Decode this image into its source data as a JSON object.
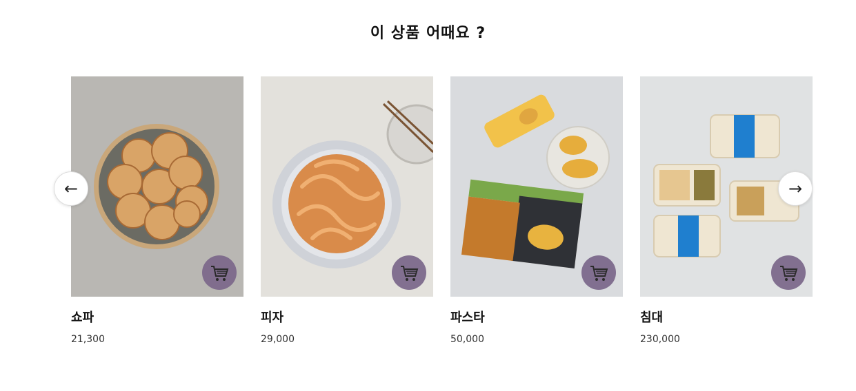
{
  "section": {
    "title": "이 상품 어때요 ?"
  },
  "nav": {
    "prev_symbol": "←",
    "next_symbol": "→"
  },
  "products": [
    {
      "name": "쇼파",
      "price": "21,300"
    },
    {
      "name": "피자",
      "price": "29,000"
    },
    {
      "name": "파스타",
      "price": "50,000"
    },
    {
      "name": "침대",
      "price": "230,000"
    }
  ],
  "colors": {
    "cart_button": "#7d6a8c",
    "text": "#111111"
  },
  "icons": {
    "cart": "shopping-cart-icon",
    "prev": "arrow-left-icon",
    "next": "arrow-right-icon"
  }
}
